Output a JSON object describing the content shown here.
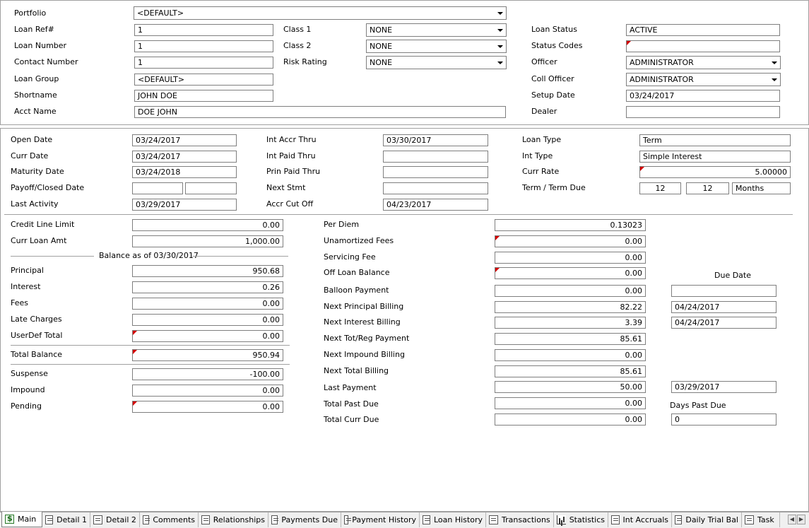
{
  "header": {
    "portfolio_label": "Portfolio",
    "portfolio_value": "<DEFAULT>",
    "loan_ref_label": "Loan Ref#",
    "loan_ref_value": "1",
    "loan_number_label": "Loan Number",
    "loan_number_value": "1",
    "contact_number_label": "Contact Number",
    "contact_number_value": "1",
    "loan_group_label": "Loan Group",
    "loan_group_value": "<DEFAULT>",
    "shortname_label": "Shortname",
    "shortname_value": "JOHN DOE",
    "acct_name_label": "Acct Name",
    "acct_name_value": "DOE JOHN",
    "class1_label": "Class 1",
    "class1_value": "NONE",
    "class2_label": "Class 2",
    "class2_value": "NONE",
    "risk_rating_label": "Risk Rating",
    "risk_rating_value": "NONE",
    "loan_status_label": "Loan Status",
    "loan_status_value": "ACTIVE",
    "status_codes_label": "Status Codes",
    "status_codes_value": "",
    "officer_label": "Officer",
    "officer_value": "ADMINISTRATOR",
    "coll_officer_label": "Coll Officer",
    "coll_officer_value": "ADMINISTRATOR",
    "setup_date_label": "Setup Date",
    "setup_date_value": "03/24/2017",
    "dealer_label": "Dealer",
    "dealer_value": ""
  },
  "dates": {
    "open_date_label": "Open Date",
    "open_date_value": "03/24/2017",
    "curr_date_label": "Curr Date",
    "curr_date_value": "03/24/2017",
    "maturity_date_label": "Maturity Date",
    "maturity_date_value": "03/24/2018",
    "payoff_label": "Payoff/Closed Date",
    "payoff_value1": "",
    "payoff_value2": "",
    "last_activity_label": "Last Activity",
    "last_activity_value": "03/29/2017",
    "int_accr_thru_label": "Int Accr Thru",
    "int_accr_thru_value": "03/30/2017",
    "int_paid_thru_label": "Int Paid Thru",
    "int_paid_thru_value": "",
    "prin_paid_thru_label": "Prin Paid Thru",
    "prin_paid_thru_value": "",
    "next_stmt_label": "Next Stmt",
    "next_stmt_value": "",
    "accr_cut_off_label": "Accr Cut Off",
    "accr_cut_off_value": "04/23/2017",
    "loan_type_label": "Loan Type",
    "loan_type_value": "Term",
    "int_type_label": "Int Type",
    "int_type_value": "Simple Interest",
    "curr_rate_label": "Curr Rate",
    "curr_rate_value": "5.00000",
    "term_label": "Term / Term Due",
    "term_value": "12",
    "term_due_value": "12",
    "term_unit": "Months"
  },
  "balances": {
    "credit_line_label": "Credit Line Limit",
    "credit_line_value": "0.00",
    "curr_loan_amt_label": "Curr Loan Amt",
    "curr_loan_amt_value": "1,000.00",
    "balance_as_of": "Balance as of 03/30/2017",
    "principal_label": "Principal",
    "principal_value": "950.68",
    "interest_label": "Interest",
    "interest_value": "0.26",
    "fees_label": "Fees",
    "fees_value": "0.00",
    "late_charges_label": "Late Charges",
    "late_charges_value": "0.00",
    "userdef_total_label": "UserDef Total",
    "userdef_total_value": "0.00",
    "total_balance_label": "Total Balance",
    "total_balance_value": "950.94",
    "suspense_label": "Suspense",
    "suspense_value": "-100.00",
    "impound_label": "Impound",
    "impound_value": "0.00",
    "pending_label": "Pending",
    "pending_value": "0.00"
  },
  "billing": {
    "per_diem_label": "Per Diem",
    "per_diem_value": "0.13023",
    "unamortized_fees_label": "Unamortized Fees",
    "unamortized_fees_value": "0.00",
    "servicing_fee_label": "Servicing Fee",
    "servicing_fee_value": "0.00",
    "off_loan_balance_label": "Off Loan Balance",
    "off_loan_balance_value": "0.00",
    "balloon_payment_label": "Balloon Payment",
    "balloon_payment_value": "0.00",
    "next_principal_billing_label": "Next Principal Billing",
    "next_principal_billing_value": "82.22",
    "next_interest_billing_label": "Next Interest Billing",
    "next_interest_billing_value": "3.39",
    "next_tot_reg_payment_label": "Next Tot/Reg Payment",
    "next_tot_reg_payment_value": "85.61",
    "next_impound_billing_label": "Next Impound Billing",
    "next_impound_billing_value": "0.00",
    "next_total_billing_label": "Next Total Billing",
    "next_total_billing_value": "85.61",
    "last_payment_label": "Last Payment",
    "last_payment_value": "50.00",
    "total_past_due_label": "Total Past Due",
    "total_past_due_value": "0.00",
    "total_curr_due_label": "Total Curr Due",
    "total_curr_due_value": "0.00",
    "due_date_label": "Due Date",
    "due_date_balloon": "",
    "due_date_principal": "04/24/2017",
    "due_date_interest": "04/24/2017",
    "last_payment_date": "03/29/2017",
    "days_past_due_label": "Days Past Due",
    "days_past_due_value": "0"
  },
  "tabs": [
    "Main",
    "Detail 1",
    "Detail 2",
    "Comments",
    "Relationships",
    "Payments Due",
    "Payment History",
    "Loan History",
    "Transactions",
    "Statistics",
    "Int Accruals",
    "Daily Trial Bal",
    "Task"
  ],
  "colors": {
    "flag": "#d40000",
    "border": "#7f7f7f",
    "tabbar": "#f0f0f0"
  }
}
